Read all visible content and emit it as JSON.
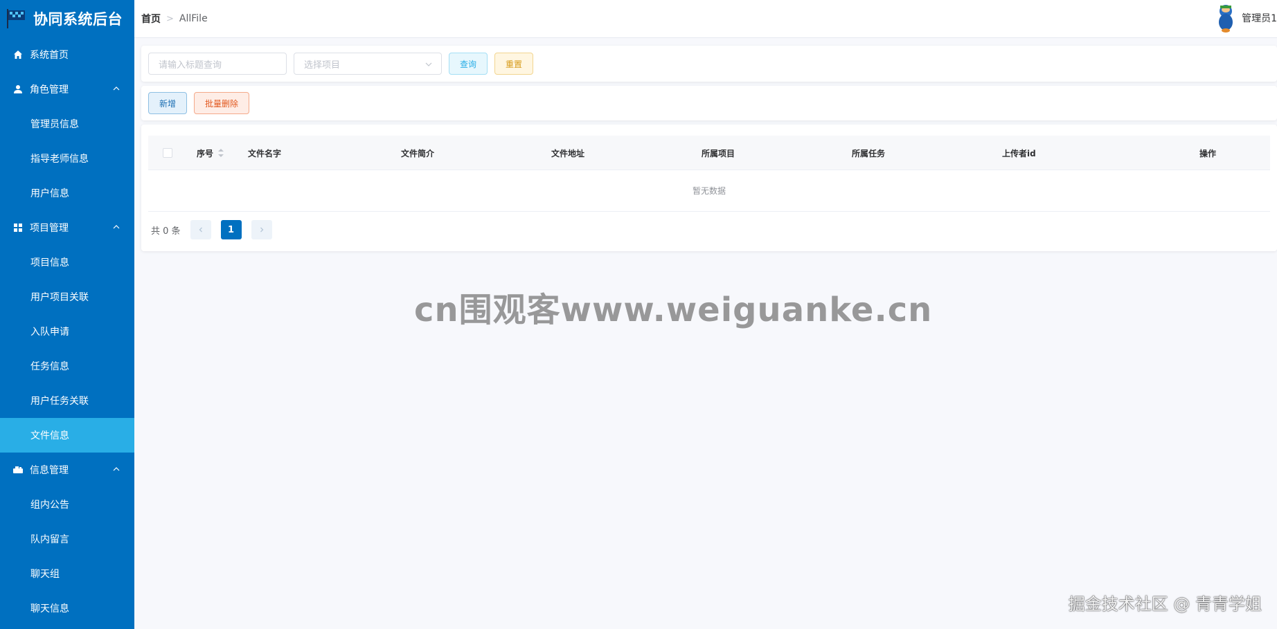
{
  "app": {
    "title": "协同系统后台"
  },
  "sidebar": {
    "items": [
      {
        "label": "系统首页",
        "icon": "home-icon",
        "type": "top"
      },
      {
        "label": "角色管理",
        "icon": "user-icon",
        "type": "group"
      },
      {
        "label": "管理员信息",
        "type": "sub"
      },
      {
        "label": "指导老师信息",
        "type": "sub"
      },
      {
        "label": "用户信息",
        "type": "sub"
      },
      {
        "label": "项目管理",
        "icon": "grid-icon",
        "type": "group"
      },
      {
        "label": "项目信息",
        "type": "sub"
      },
      {
        "label": "用户项目关联",
        "type": "sub"
      },
      {
        "label": "入队申请",
        "type": "sub"
      },
      {
        "label": "任务信息",
        "type": "sub"
      },
      {
        "label": "用户任务关联",
        "type": "sub"
      },
      {
        "label": "文件信息",
        "type": "sub",
        "active": true
      },
      {
        "label": "信息管理",
        "icon": "message-icon",
        "type": "group"
      },
      {
        "label": "组内公告",
        "type": "sub"
      },
      {
        "label": "队内留言",
        "type": "sub"
      },
      {
        "label": "聊天组",
        "type": "sub"
      },
      {
        "label": "聊天信息",
        "type": "sub"
      }
    ]
  },
  "header": {
    "breadcrumb_home": "首页",
    "breadcrumb_current": "AllFile",
    "username": "管理员1"
  },
  "search": {
    "title_placeholder": "请输入标题查询",
    "project_placeholder": "选择项目",
    "query_label": "查询",
    "reset_label": "重置"
  },
  "actions": {
    "add_label": "新增",
    "batch_delete_label": "批量删除"
  },
  "table": {
    "columns": [
      "序号",
      "文件名字",
      "文件简介",
      "文件地址",
      "所属项目",
      "所属任务",
      "上传者id",
      "操作"
    ],
    "empty_text": "暂无数据"
  },
  "pagination": {
    "total_text": "共 0 条",
    "current_page": "1"
  },
  "watermarks": {
    "center": "cn围观客www.weiguanke.cn",
    "corner": "掘金技术社区 @ 青青学姐"
  },
  "colors": {
    "sidebar_bg": "#0070c0",
    "sidebar_active": "#29aee6",
    "page_bg": "#f7f8fc"
  }
}
